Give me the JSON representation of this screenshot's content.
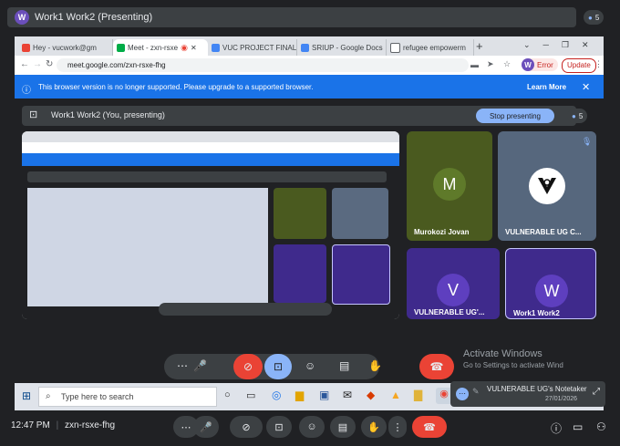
{
  "top_bar": {
    "badge": "W",
    "title": "Work1 Work2 (Presenting)",
    "participants": "5"
  },
  "chrome": {
    "tabs": [
      {
        "label": "Hey - vucwork@gm",
        "color": "#ea4335"
      },
      {
        "label": "Meet - zxn-rsxe",
        "color": "#00ac47"
      },
      {
        "label": "VUC PROJECT FINAL",
        "color": "#4285f4"
      },
      {
        "label": "SRIUP - Google Docs",
        "color": "#4285f4"
      },
      {
        "label": "refugee empowerm",
        "color": "#5f6368"
      }
    ],
    "url": "meet.google.com/zxn-rsxe-fhg",
    "profile_badge": "W",
    "profile_label": "Error",
    "update_label": "Update",
    "banner_text": "This browser version is no longer supported. Please upgrade to a supported browser.",
    "banner_link": "Learn More"
  },
  "meet": {
    "present_title": "Work1 Work2 (You, presenting)",
    "stop_label": "Stop presenting",
    "participants": "5",
    "tiles": [
      {
        "name": "Murokozi Jovan",
        "initial": "M"
      },
      {
        "name": "VULNERABLE UG C...",
        "initial": ""
      },
      {
        "name": "VULNERABLE UG'...",
        "initial": "V"
      },
      {
        "name": "Work1 Work2",
        "initial": "W"
      }
    ]
  },
  "watermark": {
    "title": "Activate Windows",
    "sub": "Go to Settings to activate Windows."
  },
  "taskbar": {
    "search_placeholder": "Type here to search"
  },
  "notification": {
    "text": "VULNERABLE UG's Notetaker",
    "date": "27/01/2026"
  },
  "bottom": {
    "time": "12:47 PM",
    "code": "zxn-rsxe-fhg"
  },
  "colors": {
    "accent": "#1a73e8",
    "hangup": "#ea4335",
    "green_tile": "#4a5a1f",
    "purple_tile": "#3f2a8c"
  }
}
